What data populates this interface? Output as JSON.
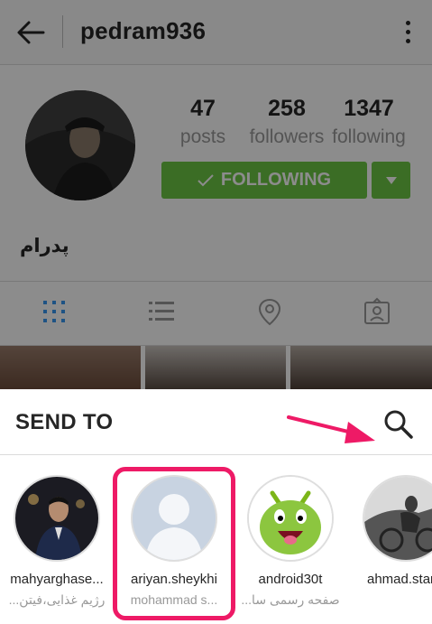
{
  "header": {
    "username": "pedram936"
  },
  "profile": {
    "stats": [
      {
        "value": "47",
        "label": "posts"
      },
      {
        "value": "258",
        "label": "followers"
      },
      {
        "value": "1347",
        "label": "following"
      }
    ],
    "follow_button": "FOLLOWING",
    "full_name": "پدرام"
  },
  "tabs": [
    "grid-icon",
    "list-icon",
    "location-pin-icon",
    "tagged-photos-icon"
  ],
  "send_sheet": {
    "title": "SEND TO",
    "recipients": [
      {
        "name": "mahyarghase...",
        "subtitle": "رژیم غذایی،فیتن..."
      },
      {
        "name": "ariyan.sheykhi",
        "subtitle": "mohammad s..."
      },
      {
        "name": "android30t",
        "subtitle": "صفحه رسمی سا..."
      },
      {
        "name": "ahmad.star",
        "subtitle": ""
      }
    ]
  },
  "colors": {
    "follow_green": "#6cc644",
    "highlight_pink": "#ee1a66",
    "annotation_arrow": "#ee1a66"
  }
}
